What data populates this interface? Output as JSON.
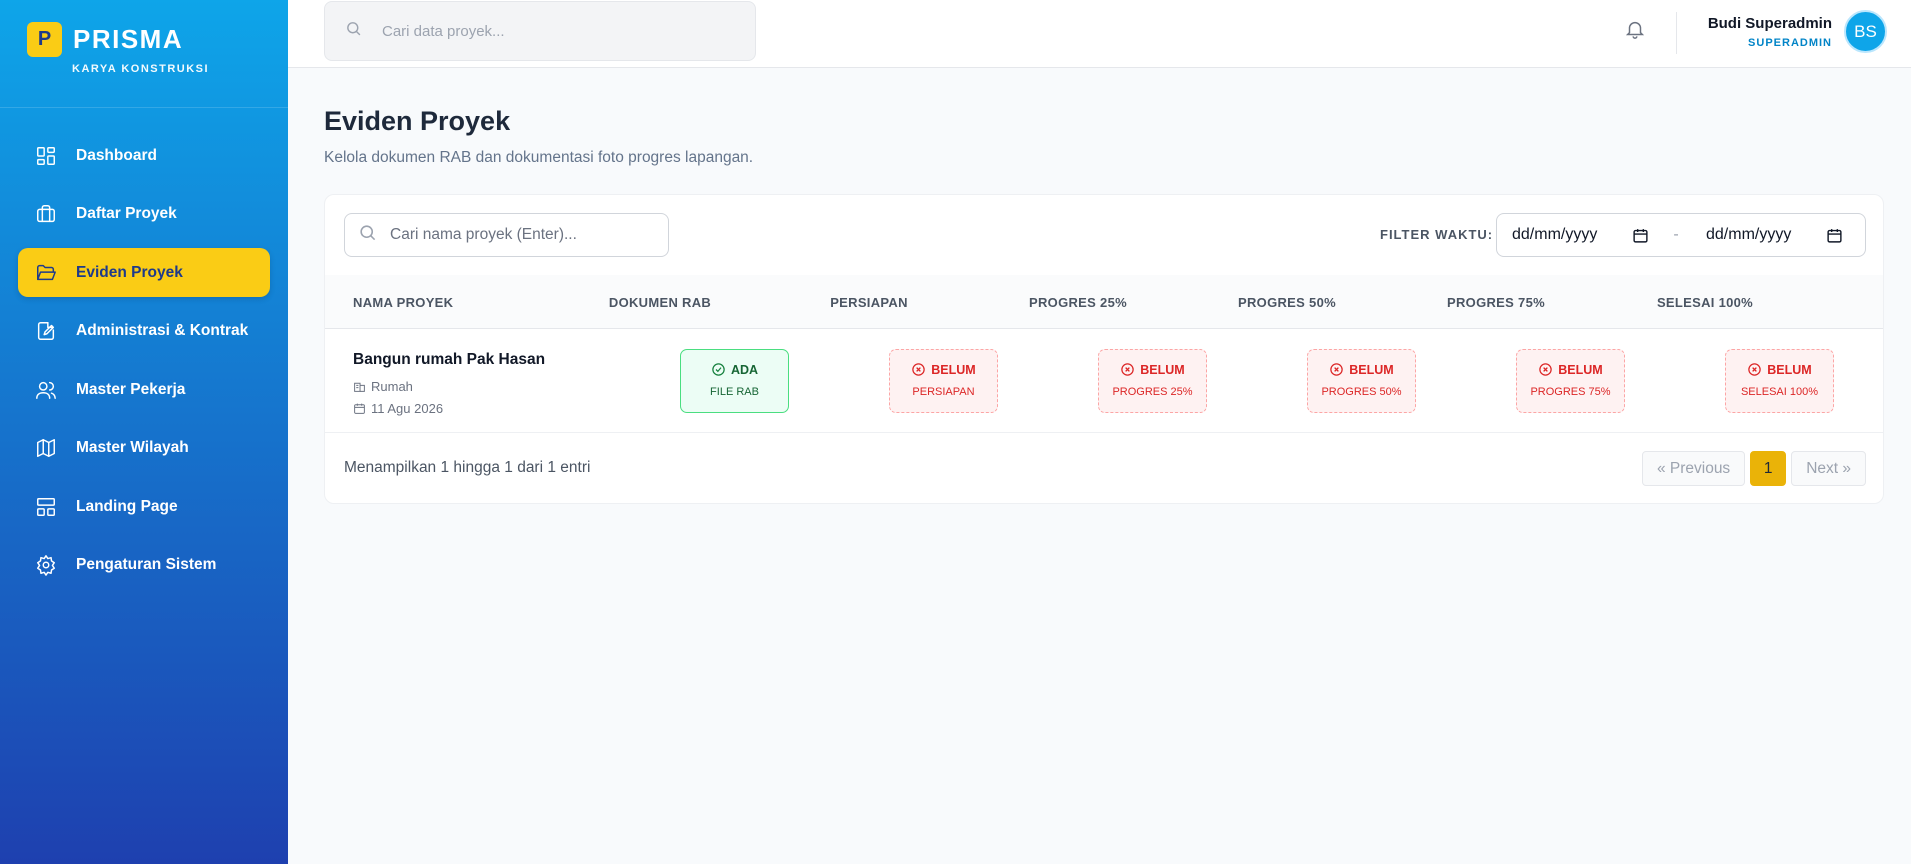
{
  "brand": {
    "logo_letter": "P",
    "name": "PRISMA",
    "subtitle": "KARYA KONSTRUKSI"
  },
  "sidebar": {
    "items": [
      {
        "label": "Dashboard",
        "icon": "dashboard-grid-icon",
        "active": false
      },
      {
        "label": "Daftar Proyek",
        "icon": "briefcase-icon",
        "active": false
      },
      {
        "label": "Eviden Proyek",
        "icon": "folder-open-icon",
        "active": true
      },
      {
        "label": "Administrasi & Kontrak",
        "icon": "edit-document-icon",
        "active": false
      },
      {
        "label": "Master Pekerja",
        "icon": "users-icon",
        "active": false
      },
      {
        "label": "Master Wilayah",
        "icon": "map-icon",
        "active": false
      },
      {
        "label": "Landing Page",
        "icon": "layout-icon",
        "active": false
      },
      {
        "label": "Pengaturan Sistem",
        "icon": "gear-icon",
        "active": false
      }
    ],
    "active_color": "#facc15"
  },
  "topbar": {
    "search_placeholder": "Cari data proyek...",
    "user_name": "Budi Superadmin",
    "user_role": "SUPERADMIN",
    "avatar_initials": "BS"
  },
  "page": {
    "title": "Eviden Proyek",
    "subtitle": "Kelola dokumen RAB dan dokumentasi foto progres lapangan."
  },
  "filters": {
    "search_placeholder": "Cari nama proyek (Enter)...",
    "time_label": "FILTER WAKTU:",
    "date_from": "dd/mm/yyyy",
    "date_separator": "-",
    "date_to": "dd/mm/yyyy"
  },
  "table": {
    "columns": [
      "NAMA PROYEK",
      "DOKUMEN RAB",
      "PERSIAPAN",
      "PROGRES 25%",
      "PROGRES 50%",
      "PROGRES 75%",
      "SELESAI 100%"
    ],
    "rows": [
      {
        "name": "Bangun rumah Pak Hasan",
        "type": "Rumah",
        "date": "11 Agu 2026",
        "statuses": [
          {
            "state": "ADA",
            "detail": "FILE RAB",
            "ok": true
          },
          {
            "state": "BELUM",
            "detail": "PERSIAPAN",
            "ok": false
          },
          {
            "state": "BELUM",
            "detail": "PROGRES 25%",
            "ok": false
          },
          {
            "state": "BELUM",
            "detail": "PROGRES 50%",
            "ok": false
          },
          {
            "state": "BELUM",
            "detail": "PROGRES 75%",
            "ok": false
          },
          {
            "state": "BELUM",
            "detail": "SELESAI 100%",
            "ok": false
          }
        ]
      }
    ]
  },
  "pagination": {
    "info": "Menampilkan 1 hingga 1 dari 1 entri",
    "prev": "« Previous",
    "current": "1",
    "next": "Next »"
  }
}
